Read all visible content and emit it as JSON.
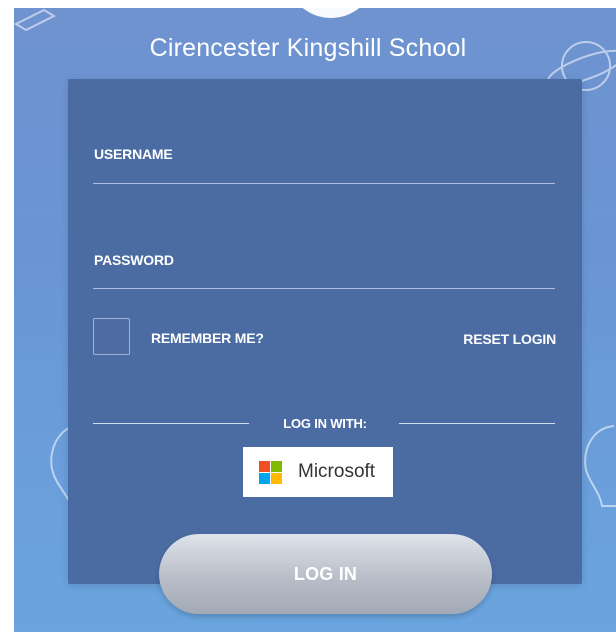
{
  "school": {
    "name": "Cirencester Kingshill School"
  },
  "form": {
    "username_label": "USERNAME",
    "password_label": "PASSWORD",
    "remember_label": "REMEMBER ME?",
    "remember_checked": false,
    "reset_label": "RESET LOGIN"
  },
  "sso": {
    "heading": "LOG IN WITH:",
    "providers": [
      {
        "label": "Microsoft",
        "icon": "microsoft-logo-icon"
      }
    ]
  },
  "actions": {
    "login_label": "LOG IN"
  },
  "colors": {
    "background": "#6e93cf",
    "card": "#4b6ba3",
    "login_button": "#b8bec8",
    "ms_red": "#f25022",
    "ms_green": "#7fba00",
    "ms_blue": "#00a4ef",
    "ms_yellow": "#ffb900"
  }
}
